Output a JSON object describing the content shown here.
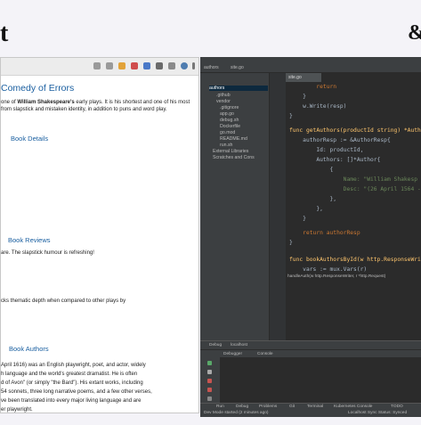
{
  "banner": {
    "left_logo": "t",
    "right_logo": "&"
  },
  "browser": {
    "title": "Comedy of Errors",
    "intro_line1": "one of William Shakespeare's early plays. It is his shortest and one of his most",
    "intro_line2": "from slapstick and mistaken identity, in addition to puns and word play.",
    "intro_bold": "William Shakespeare's",
    "details_heading": "Book Details",
    "reviews_heading": "Book Reviews",
    "review1": "are. The slapstick humour is refreshing!",
    "review2": "cks thematic depth when compared to other plays by",
    "authors_heading": "Book Authors",
    "author_lines": [
      "April 1616) was an English playwright, poet, and actor, widely",
      "h language and the world's greatest dramatist. He is often",
      "d of Avon\" (or simply \"the Bard\"). His extant works, including",
      "54 sonnets, three long narrative poems, and a few other verses,",
      "ve been translated into every major living language and are",
      "er playwright."
    ]
  },
  "ide": {
    "top_tabs": [
      "authors",
      "site.go"
    ],
    "project_root": "authors",
    "tree": [
      ".github",
      "vendor",
      ".gitignore",
      "app.go",
      "debug.sh",
      "Dockerfile",
      "go.mod",
      "README.md",
      "run.sh",
      "External Libraries",
      "Scratches and Cons"
    ],
    "editor_tab": "site.go",
    "code": [
      "        return",
      "    }",
      "    w.Write(resp)",
      "}",
      "",
      "func getAuthors(productId string) *Auth",
      "    authorResp := &AuthorResp{",
      "        Id: productId,",
      "        Authors: []*Author{",
      "            {",
      "                Name: \"William Shakesp",
      "                Desc: \"(26 April 1564 -",
      "            },",
      "        },",
      "    }",
      "",
      "    return authorResp",
      "}",
      "",
      "func bookAuthorsById(w http.ResponseWri",
      "    vars := mux.Vars(r)"
    ],
    "breadcrumb": "handleAuth(w http.ResponseWriter, r *http.Request)",
    "debug_tab": "Debug",
    "debug_config": "localhost",
    "debugger_label": "Debugger",
    "console_label": "Console",
    "bottom_tabs": [
      "Run",
      "Debug",
      "Problems",
      "Git",
      "Terminal",
      "Kubernetes Console",
      "TODO"
    ],
    "status_left": "Dev Mode started (2 minutes ago)",
    "status_right": "Localhost Sync Status: Synced"
  },
  "colors": {
    "accent_blue": "#1a5fa0",
    "ide_bg": "#2b2b2b",
    "ide_panel": "#3c3f41"
  }
}
